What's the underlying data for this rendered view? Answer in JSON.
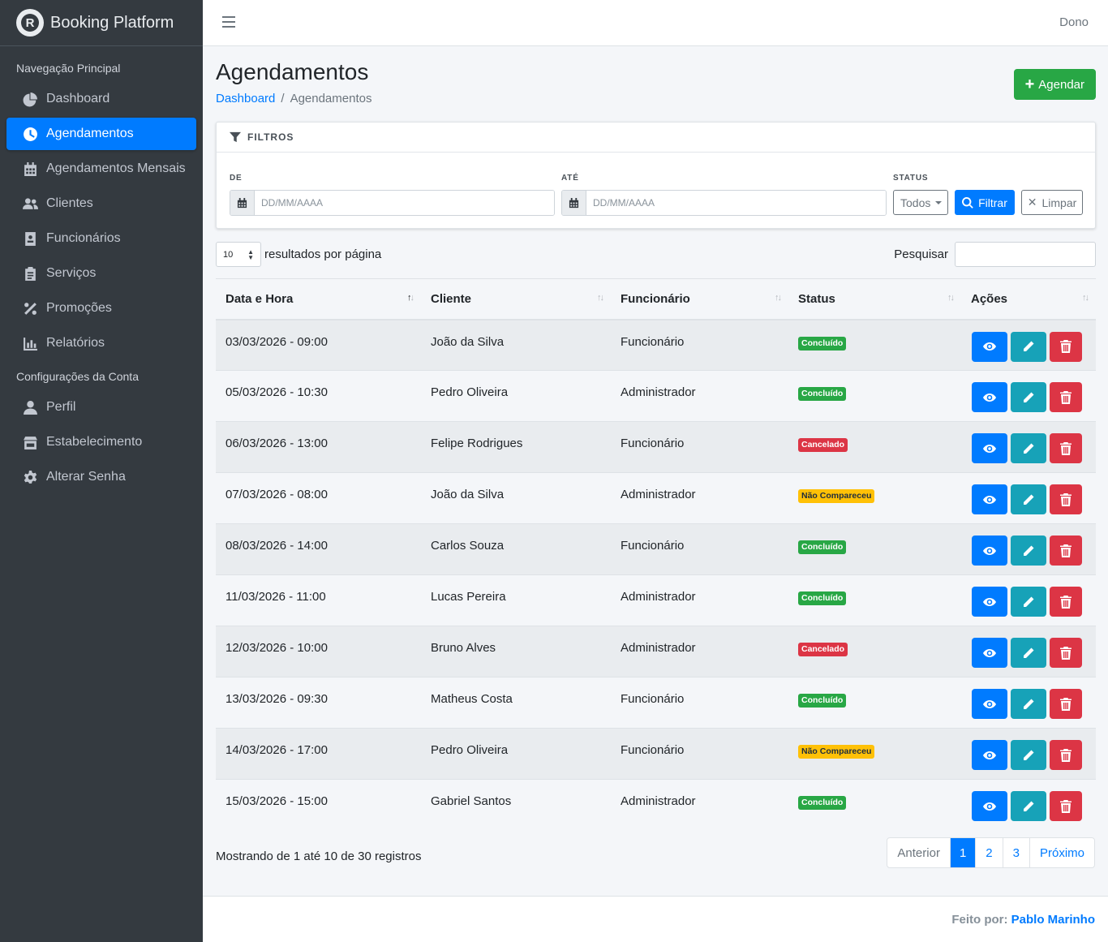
{
  "brand": {
    "name": "Booking Platform",
    "logo_letter": "R"
  },
  "sidebar": {
    "main_header": "Navegação Principal",
    "main_items": [
      {
        "label": "Dashboard",
        "icon": "pie-chart-icon"
      },
      {
        "label": "Agendamentos",
        "icon": "clock-icon",
        "active": true
      },
      {
        "label": "Agendamentos Mensais",
        "icon": "calendar-icon"
      },
      {
        "label": "Clientes",
        "icon": "users-icon"
      },
      {
        "label": "Funcionários",
        "icon": "id-badge-icon"
      },
      {
        "label": "Serviços",
        "icon": "clipboard-icon"
      },
      {
        "label": "Promoções",
        "icon": "percent-icon"
      },
      {
        "label": "Relatórios",
        "icon": "bar-chart-icon"
      }
    ],
    "account_header": "Configurações da Conta",
    "account_items": [
      {
        "label": "Perfil",
        "icon": "user-icon"
      },
      {
        "label": "Estabelecimento",
        "icon": "store-icon"
      },
      {
        "label": "Alterar Senha",
        "icon": "gear-icon"
      }
    ]
  },
  "topbar": {
    "user": "Dono"
  },
  "page": {
    "title": "Agendamentos",
    "breadcrumb": {
      "home": "Dashboard",
      "separator": "/",
      "current": "Agendamentos"
    },
    "add_button": "Agendar"
  },
  "filters": {
    "header": "FILTROS",
    "from_label": "DE",
    "to_label": "ATÉ",
    "status_label": "STATUS",
    "date_placeholder": "DD/MM/AAAA",
    "status_value": "Todos",
    "filter_button": "Filtrar",
    "clear_button": "Limpar"
  },
  "table_controls": {
    "page_length": "10",
    "length_suffix": "resultados por página",
    "search_label": "Pesquisar"
  },
  "table": {
    "columns": [
      "Data e Hora",
      "Cliente",
      "Funcionário",
      "Status",
      "Ações"
    ],
    "rows": [
      {
        "datetime": "03/03/2026 - 09:00",
        "client": "João da Silva",
        "employee": "Funcionário",
        "status": "Concluído",
        "tone": "green"
      },
      {
        "datetime": "05/03/2026 - 10:30",
        "client": "Pedro Oliveira",
        "employee": "Administrador",
        "status": "Concluído",
        "tone": "green"
      },
      {
        "datetime": "06/03/2026 - 13:00",
        "client": "Felipe Rodrigues",
        "employee": "Funcionário",
        "status": "Cancelado",
        "tone": "red"
      },
      {
        "datetime": "07/03/2026 - 08:00",
        "client": "João da Silva",
        "employee": "Administrador",
        "status": "Não Compareceu",
        "tone": "yellow"
      },
      {
        "datetime": "08/03/2026 - 14:00",
        "client": "Carlos Souza",
        "employee": "Funcionário",
        "status": "Concluído",
        "tone": "green"
      },
      {
        "datetime": "11/03/2026 - 11:00",
        "client": "Lucas Pereira",
        "employee": "Administrador",
        "status": "Concluído",
        "tone": "green"
      },
      {
        "datetime": "12/03/2026 - 10:00",
        "client": "Bruno Alves",
        "employee": "Administrador",
        "status": "Cancelado",
        "tone": "red"
      },
      {
        "datetime": "13/03/2026 - 09:30",
        "client": "Matheus Costa",
        "employee": "Funcionário",
        "status": "Concluído",
        "tone": "green"
      },
      {
        "datetime": "14/03/2026 - 17:00",
        "client": "Pedro Oliveira",
        "employee": "Funcionário",
        "status": "Não Compareceu",
        "tone": "yellow"
      },
      {
        "datetime": "15/03/2026 - 15:00",
        "client": "Gabriel Santos",
        "employee": "Administrador",
        "status": "Concluído",
        "tone": "green"
      }
    ]
  },
  "pagination": {
    "info": "Mostrando de 1 até 10 de 30 registros",
    "prev": "Anterior",
    "pages": [
      "1",
      "2",
      "3"
    ],
    "next": "Próximo"
  },
  "footer": {
    "prefix": "Feito por:",
    "author": "Pablo Marinho"
  }
}
